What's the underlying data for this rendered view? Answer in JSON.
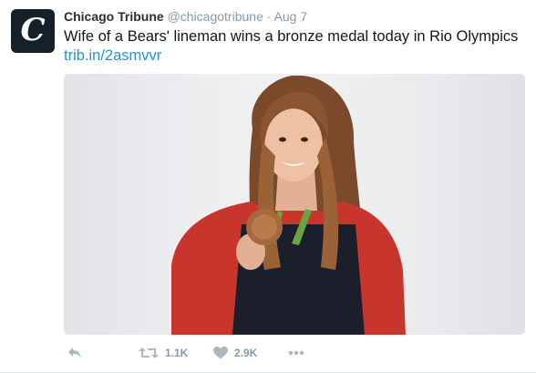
{
  "tweet": {
    "author_name": "Chicago Tribune",
    "handle": "@chicagotribune",
    "separator": "·",
    "timestamp": "Aug 7",
    "text": "Wife of a Bears' lineman wins a bronze medal today in Rio Olympics",
    "link": "trib.in/2asmvvr",
    "avatar_letter": "C"
  },
  "actions": {
    "retweet_count": "1.1K",
    "like_count": "2.9K"
  },
  "icons": {
    "reply": "reply-icon",
    "retweet": "retweet-icon",
    "like": "heart-icon",
    "more": "more-icon"
  },
  "colors": {
    "link": "#1b95e0",
    "icon_gray": "#aab8c2",
    "secondary_text": "#8899a6",
    "avatar_bg": "#15202b"
  }
}
